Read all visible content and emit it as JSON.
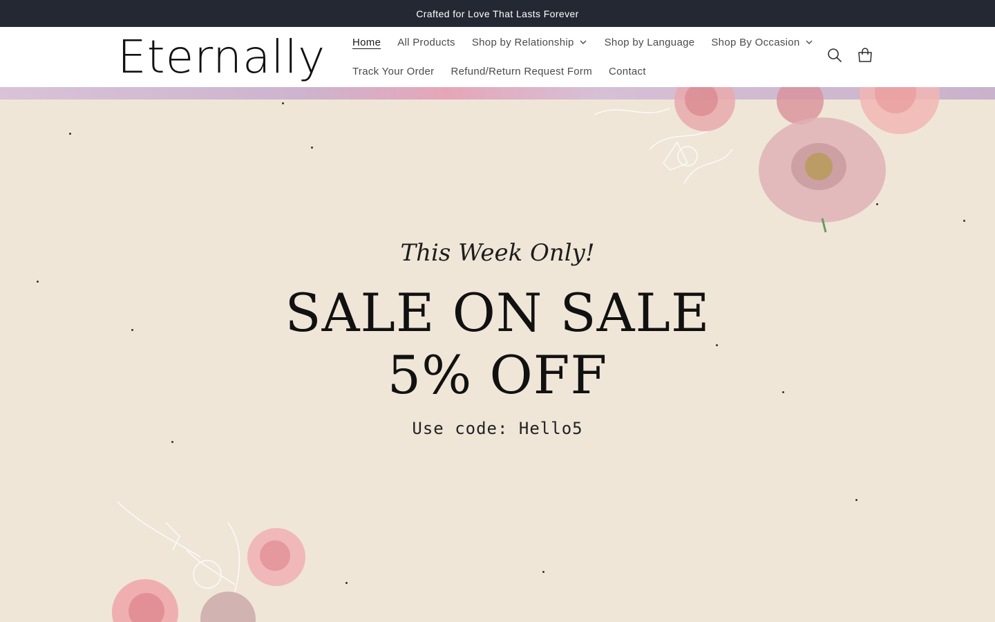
{
  "announcement": {
    "text": "Crafted for Love That Lasts Forever"
  },
  "header": {
    "logo": "Eternally",
    "nav_row1": [
      {
        "label": "Home",
        "active": true,
        "dropdown": false
      },
      {
        "label": "All Products",
        "active": false,
        "dropdown": false
      },
      {
        "label": "Shop by Relationship",
        "active": false,
        "dropdown": true
      },
      {
        "label": "Shop by Language",
        "active": false,
        "dropdown": false
      },
      {
        "label": "Shop By Occasion",
        "active": false,
        "dropdown": true
      }
    ],
    "nav_row2": [
      {
        "label": "Track Your Order"
      },
      {
        "label": "Refund/Return Request Form"
      },
      {
        "label": "Contact"
      }
    ],
    "icons": {
      "search": "search-icon",
      "cart": "cart-icon"
    }
  },
  "hero": {
    "tagline": "This Week Only!",
    "headline_line1": "SALE ON SALE",
    "headline_line2": "5% OFF",
    "code_text": "Use code: Hello5"
  },
  "colors": {
    "announcement_bg": "#242833",
    "hero_bg": "#efe6d8",
    "text_dark": "#111111"
  }
}
